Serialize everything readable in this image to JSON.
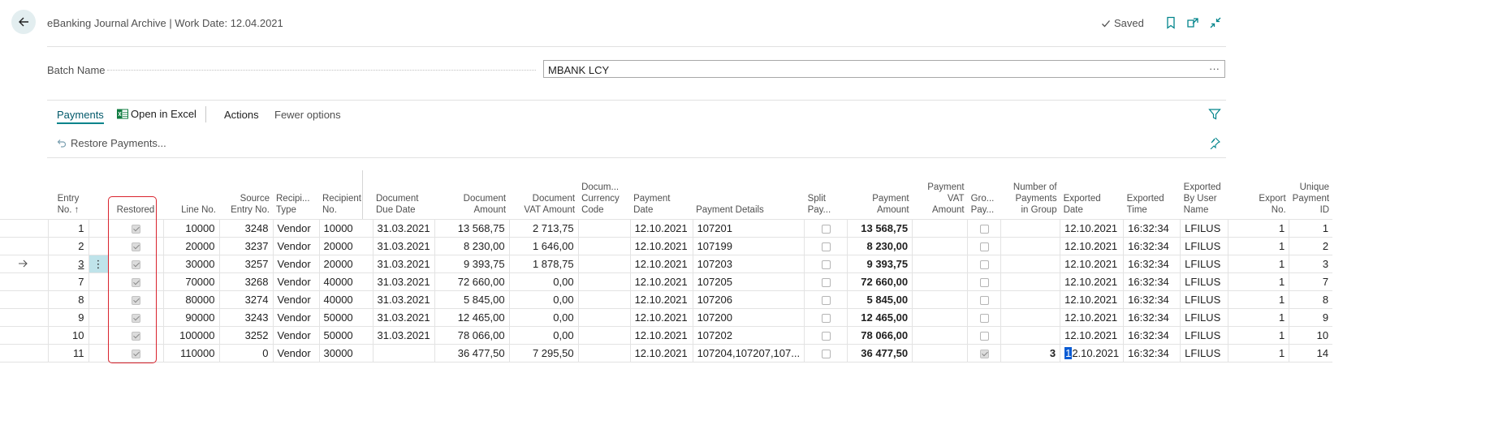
{
  "header": {
    "title": "eBanking Journal Archive | Work Date: 12.04.2021",
    "saved_label": "Saved"
  },
  "batch": {
    "label": "Batch Name",
    "value": "MBANK LCY",
    "more": "···"
  },
  "toolbar": {
    "payments": "Payments",
    "open_in_excel": "Open in Excel",
    "actions": "Actions",
    "fewer_options": "Fewer options",
    "restore_payments": "Restore Payments..."
  },
  "columns": [
    "Entry\nNo. ↑",
    "Restored",
    "Line No.",
    "Source\nEntry No.",
    "Recipi...\nType",
    "Recipient\nNo.",
    "Document\nDue Date",
    "Document\nAmount",
    "Document\nVAT Amount",
    "Docum...\nCurrency\nCode",
    "Payment\nDate",
    "Payment Details",
    "Split\nPay...",
    "Payment\nAmount",
    "Payment\nVAT\nAmount",
    "Gro...\nPay...",
    "Number of\nPayments\nin Group",
    "Exported\nDate",
    "Exported\nTime",
    "Exported\nBy User\nName",
    "Export\nNo.",
    "Unique\nPayment\nID"
  ],
  "rows": [
    {
      "entry": "1",
      "restored": true,
      "line": "10000",
      "source": "3248",
      "rtype": "Vendor",
      "rno": "10000",
      "due": "31.03.2021",
      "amount": "13 568,75",
      "vat": "2 713,75",
      "cur": "",
      "pdate": "12.10.2021",
      "details": "107201",
      "split": false,
      "pamount": "13 568,75",
      "pvat": "",
      "group": false,
      "npay": "",
      "edate": "12.10.2021",
      "etime": "16:32:34",
      "euser": "LFILUS",
      "eno": "1",
      "uid": "1"
    },
    {
      "entry": "2",
      "restored": true,
      "line": "20000",
      "source": "3237",
      "rtype": "Vendor",
      "rno": "20000",
      "due": "31.03.2021",
      "amount": "8 230,00",
      "vat": "1 646,00",
      "cur": "",
      "pdate": "12.10.2021",
      "details": "107199",
      "split": false,
      "pamount": "8 230,00",
      "pvat": "",
      "group": false,
      "npay": "",
      "edate": "12.10.2021",
      "etime": "16:32:34",
      "euser": "LFILUS",
      "eno": "1",
      "uid": "2"
    },
    {
      "entry": "3",
      "restored": true,
      "line": "30000",
      "source": "3257",
      "rtype": "Vendor",
      "rno": "20000",
      "due": "31.03.2021",
      "amount": "9 393,75",
      "vat": "1 878,75",
      "cur": "",
      "pdate": "12.10.2021",
      "details": "107203",
      "split": false,
      "pamount": "9 393,75",
      "pvat": "",
      "group": false,
      "npay": "",
      "edate": "12.10.2021",
      "etime": "16:32:34",
      "euser": "LFILUS",
      "eno": "1",
      "uid": "3"
    },
    {
      "entry": "7",
      "restored": true,
      "line": "70000",
      "source": "3268",
      "rtype": "Vendor",
      "rno": "40000",
      "due": "31.03.2021",
      "amount": "72 660,00",
      "vat": "0,00",
      "cur": "",
      "pdate": "12.10.2021",
      "details": "107205",
      "split": false,
      "pamount": "72 660,00",
      "pvat": "",
      "group": false,
      "npay": "",
      "edate": "12.10.2021",
      "etime": "16:32:34",
      "euser": "LFILUS",
      "eno": "1",
      "uid": "7"
    },
    {
      "entry": "8",
      "restored": true,
      "line": "80000",
      "source": "3274",
      "rtype": "Vendor",
      "rno": "40000",
      "due": "31.03.2021",
      "amount": "5 845,00",
      "vat": "0,00",
      "cur": "",
      "pdate": "12.10.2021",
      "details": "107206",
      "split": false,
      "pamount": "5 845,00",
      "pvat": "",
      "group": false,
      "npay": "",
      "edate": "12.10.2021",
      "etime": "16:32:34",
      "euser": "LFILUS",
      "eno": "1",
      "uid": "8"
    },
    {
      "entry": "9",
      "restored": true,
      "line": "90000",
      "source": "3243",
      "rtype": "Vendor",
      "rno": "50000",
      "due": "31.03.2021",
      "amount": "12 465,00",
      "vat": "0,00",
      "cur": "",
      "pdate": "12.10.2021",
      "details": "107200",
      "split": false,
      "pamount": "12 465,00",
      "pvat": "",
      "group": false,
      "npay": "",
      "edate": "12.10.2021",
      "etime": "16:32:34",
      "euser": "LFILUS",
      "eno": "1",
      "uid": "9"
    },
    {
      "entry": "10",
      "restored": true,
      "line": "100000",
      "source": "3252",
      "rtype": "Vendor",
      "rno": "50000",
      "due": "31.03.2021",
      "amount": "78 066,00",
      "vat": "0,00",
      "cur": "",
      "pdate": "12.10.2021",
      "details": "107202",
      "split": false,
      "pamount": "78 066,00",
      "pvat": "",
      "group": false,
      "npay": "",
      "edate": "12.10.2021",
      "etime": "16:32:34",
      "euser": "LFILUS",
      "eno": "1",
      "uid": "10"
    },
    {
      "entry": "11",
      "restored": true,
      "line": "110000",
      "source": "0",
      "rtype": "Vendor",
      "rno": "30000",
      "due": "",
      "amount": "36 477,50",
      "vat": "7 295,50",
      "cur": "",
      "pdate": "12.10.2021",
      "details": "107204,107207,107...",
      "split": false,
      "pamount": "36 477,50",
      "pvat": "",
      "group": true,
      "npay": "3",
      "edate": "12.10.2021",
      "etime": "16:32:34",
      "euser": "LFILUS",
      "eno": "1",
      "uid": "14"
    }
  ],
  "selected_row_index": 2,
  "colors": {
    "accent": "#00848b",
    "bold_amount": "#00586a",
    "highlight_box": "#d9232d"
  }
}
